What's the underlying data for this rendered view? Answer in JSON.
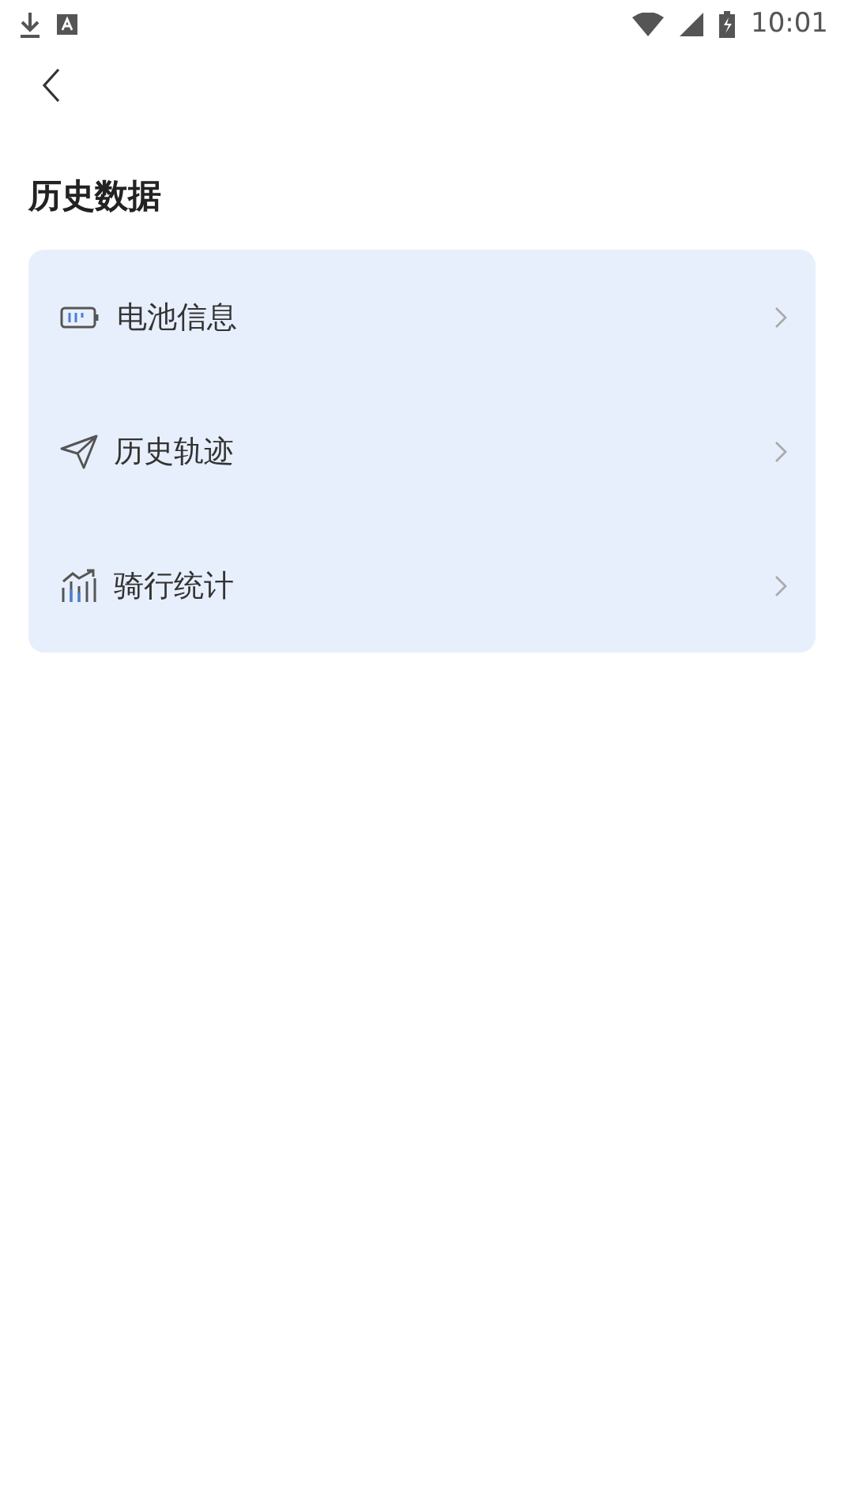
{
  "status_bar": {
    "time": "10:01"
  },
  "title": "历史数据",
  "menu": [
    {
      "kind": "battery",
      "label": "电池信息"
    },
    {
      "kind": "plane",
      "label": "历史轨迹"
    },
    {
      "kind": "chart",
      "label": "骑行统计"
    }
  ]
}
